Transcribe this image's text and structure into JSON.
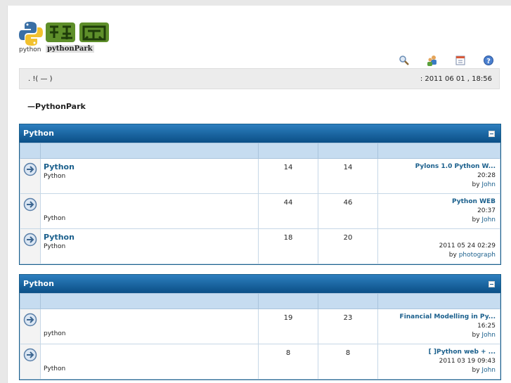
{
  "logo": {
    "label_python": "python",
    "label_park": "pythonPark"
  },
  "header_icons": [
    "search-icon",
    "users-icon",
    "calendar-icon",
    "help-icon"
  ],
  "navbar": {
    "left": ".  !(  —  )",
    "right": ": 2011 06 01 , 18:56"
  },
  "welcome": "—PythonPark",
  "forums": [
    {
      "title": "Python",
      "rows": [
        {
          "name": "Python",
          "desc": "Python",
          "topics": "14",
          "posts": "14",
          "last_title": "Pylons 1.0         Python W...",
          "last_time": "20:28",
          "by": "by",
          "last_user": "John"
        },
        {
          "name": "",
          "desc": "Python",
          "topics": "44",
          "posts": "46",
          "last_title": "Python WEB",
          "last_time": "20:37",
          "by": "by",
          "last_user": "John"
        },
        {
          "name": "Python",
          "desc": "Python",
          "topics": "18",
          "posts": "20",
          "last_title": "",
          "last_time": "2011 05 24  02:29",
          "by": "by",
          "last_user": "photograph"
        }
      ]
    },
    {
      "title": "Python",
      "rows": [
        {
          "name": "",
          "desc": "python",
          "topics": "19",
          "posts": "23",
          "last_title": "Financial Modelling in Py...",
          "last_time": "16:25",
          "by": "by",
          "last_user": "John"
        },
        {
          "name": "",
          "desc": "Python",
          "topics": "8",
          "posts": "8",
          "last_title": "[   ]Python     web     +     ...",
          "last_time": "2011 03 19  09:43",
          "by": "by",
          "last_user": "John"
        }
      ]
    }
  ],
  "colors": {
    "header_blue": "#0b4f86",
    "link_blue": "#1a5f8c",
    "subheader": "#c6dcf0"
  }
}
